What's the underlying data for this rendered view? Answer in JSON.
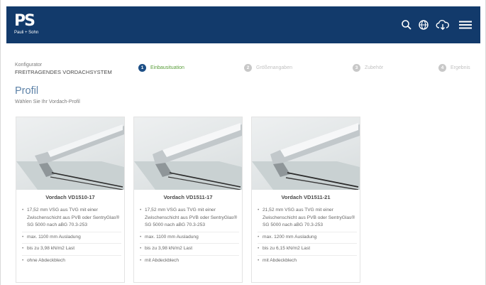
{
  "header": {
    "logo_mark": "PS",
    "logo_sub": "Pauli + Sohn",
    "icons": [
      "search-icon",
      "globe-icon",
      "cloud-download-icon",
      "menu-icon"
    ]
  },
  "breadcrumb": {
    "kicker": "Konfigurator",
    "title": "FREITRAGENDES VORDACHSYSTEM"
  },
  "steps": [
    {
      "num": "1",
      "label": "Einbausituation",
      "active": true
    },
    {
      "num": "2",
      "label": "Größenangaben",
      "active": false
    },
    {
      "num": "3",
      "label": "Zubehör",
      "active": false
    },
    {
      "num": "4",
      "label": "Ergebnis",
      "active": false
    }
  ],
  "page": {
    "title": "Profil",
    "subtitle": "Wählen Sie Ihr Vordach-Profil"
  },
  "cards": [
    {
      "title": "Vordach VD1510-17",
      "features": [
        "17,52 mm VSG aus TVG mit einer Zwischenschicht aus PVB oder SentryGlas® SG 5000 nach aBG 70.3-253",
        "max. 1100 mm Ausladung",
        "bis zu 3,98 kN/m2 Last",
        "ohne Abdeckblech"
      ]
    },
    {
      "title": "Vordach VD1511-17",
      "features": [
        "17,52 mm VSG aus TVG mit einer Zwischenschicht aus PVB oder SentryGlas® SG 5000 nach aBG 70.3-253",
        "max. 1100 mm Ausladung",
        "bis zu 3,98 kN/m2 Last",
        "mit Abdeckblech"
      ]
    },
    {
      "title": "Vordach VD1511-21",
      "features": [
        "21,52 mm VSG aus TVG mit einer Zwischenschicht aus PVB oder SentryGlas® SG 5000 nach aBG 70.3-253",
        "max. 1200 mm Ausladung",
        "bis zu 6,15 kN/m2 Last",
        "mit Abdeckblech"
      ]
    }
  ],
  "colors": {
    "header_bg": "#123a6b",
    "active_step": "#1d4f86",
    "active_label": "#5a9e3b",
    "title": "#5d82a8"
  }
}
